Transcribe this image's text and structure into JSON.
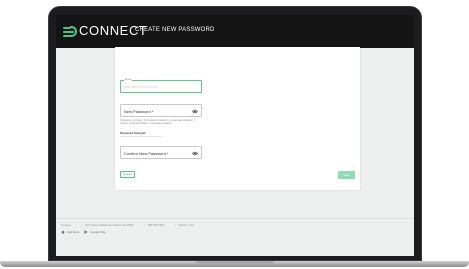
{
  "app": {
    "brand": "CONNECT",
    "page_title": "CREATE NEW PASSWORD"
  },
  "form": {
    "email": {
      "label": "Email",
      "value": "user@example.com"
    },
    "new_password": {
      "placeholder": "New Password *",
      "hint": "8 characters minimum. 30 characters maximum. 1 uppercase character. 1 number. 1 special character. 1 lowercase character."
    },
    "strength_label": "Password Strength",
    "confirm_password": {
      "placeholder": "Confirm New Password *"
    },
    "cancel_label": "Cancel",
    "save_label": "Save"
  },
  "footer": {
    "company": "Connect",
    "address": "7677 Some Address St, Atlanta, GA 30321",
    "phone": "800-555-0000",
    "version": "Version: 1.0.0",
    "app_store": "App Store",
    "google_play": "Google Play"
  },
  "colors": {
    "accent": "#4cc38a",
    "header_bg": "#141414",
    "save_disabled": "#8fdcb4"
  },
  "icons": {
    "logo": "connect-logo-icon",
    "password_visibility": "eye-icon",
    "app_store": "apple-icon",
    "google_play": "play-icon"
  }
}
